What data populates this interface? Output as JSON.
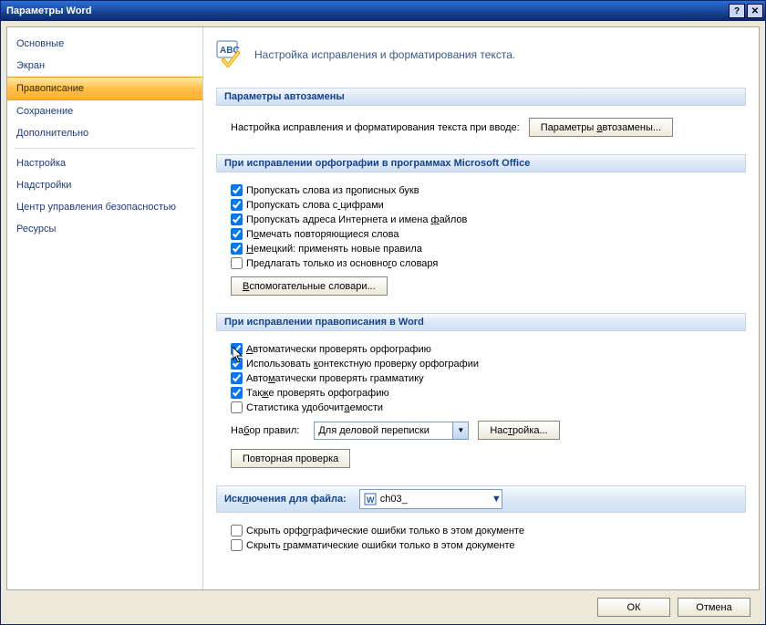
{
  "window": {
    "title": "Параметры Word"
  },
  "sidebar": {
    "items": [
      {
        "label": "Основные"
      },
      {
        "label": "Экран"
      },
      {
        "label": "Правописание",
        "selected": true
      },
      {
        "label": "Сохранение"
      },
      {
        "label": "Дополнительно"
      },
      {
        "label": "Настройка"
      },
      {
        "label": "Надстройки"
      },
      {
        "label": "Центр управления безопасностью"
      },
      {
        "label": "Ресурсы"
      }
    ]
  },
  "header": {
    "text": "Настройка исправления и форматирования текста."
  },
  "sections": {
    "autocorrect": {
      "title": "Параметры автозамены",
      "desc": "Настройка исправления и форматирования текста при вводе:",
      "button": "Параметры автозамены..."
    },
    "office_spell": {
      "title": "При исправлении орфографии в программах Microsoft Office",
      "checks": [
        {
          "label": "Пропускать слова из прописных букв",
          "checked": true,
          "u": 21
        },
        {
          "label": "Пропускать слова с цифрами",
          "checked": true,
          "u": 18
        },
        {
          "label": "Пропускать адреса Интернета и имена файлов",
          "checked": true,
          "u": 36
        },
        {
          "label": "Помечать повторяющиеся слова",
          "checked": true,
          "u": 1
        },
        {
          "label": "Немецкий: применять новые правила",
          "checked": true,
          "u": 0
        },
        {
          "label": "Предлагать только из основного словаря",
          "checked": false,
          "u": 28
        }
      ],
      "dict_button": "Вспомогательные словари..."
    },
    "word_spell": {
      "title": "При исправлении правописания в Word",
      "checks": [
        {
          "label": "Автоматически проверять орфографию",
          "checked": true,
          "u": 0
        },
        {
          "label": "Использовать контекстную проверку орфографии",
          "checked": true,
          "u": 13
        },
        {
          "label": "Автоматически проверять грамматику",
          "checked": true,
          "u": 4
        },
        {
          "label": "Также проверять орфографию",
          "checked": true,
          "u": 3
        },
        {
          "label": "Статистика удобочитаемости",
          "checked": false,
          "u": 19
        }
      ],
      "ruleset_label": "Набор правил:",
      "ruleset_value": "Для деловой переписки",
      "settings_button": "Настройка...",
      "recheck_button": "Повторная проверка"
    },
    "exceptions": {
      "title": "Исключения для файла:",
      "file_value": "ch03_",
      "checks": [
        {
          "label": "Скрыть орфографические ошибки только в этом документе",
          "checked": false,
          "u": 10
        },
        {
          "label": "Скрыть грамматические ошибки только в этом документе",
          "checked": false,
          "u": 7
        }
      ]
    }
  },
  "footer": {
    "ok": "ОК",
    "cancel": "Отмена"
  }
}
